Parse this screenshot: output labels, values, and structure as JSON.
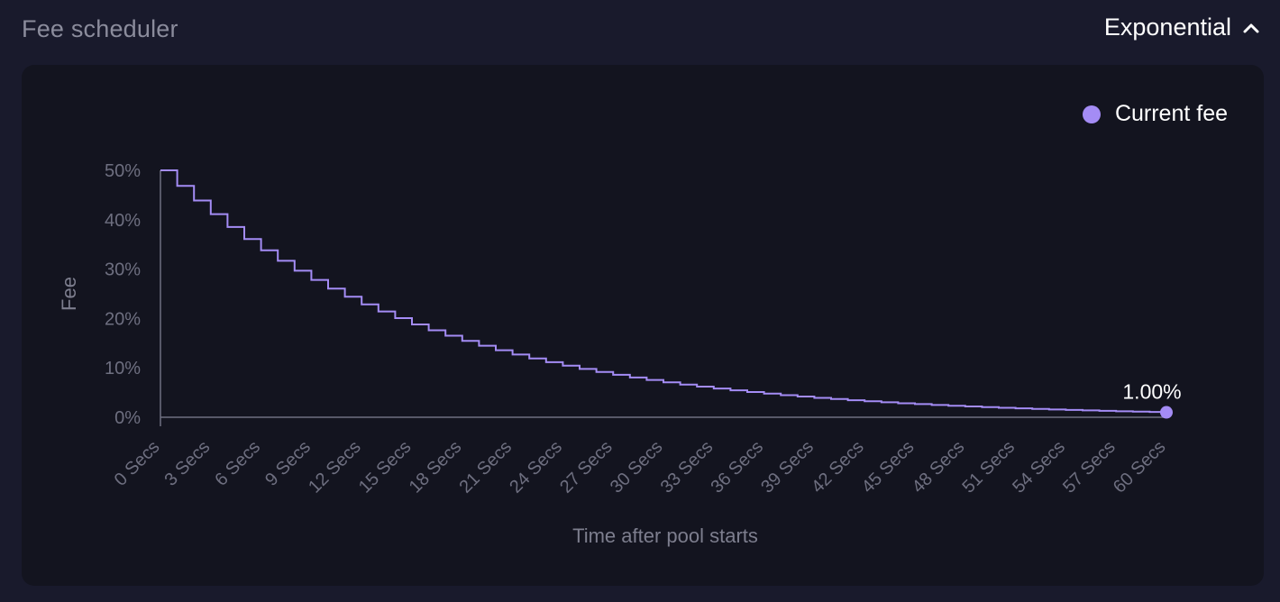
{
  "header": {
    "title": "Fee scheduler",
    "mode_label": "Exponential"
  },
  "legend": {
    "label": "Current fee"
  },
  "colors": {
    "series": "#a48cf5",
    "axis": "#6e6f80"
  },
  "icons": {
    "toggle": "chevron-up-icon"
  },
  "chart_data": {
    "type": "line",
    "step": true,
    "ylabel": "Fee",
    "xlabel": "Time after pool starts",
    "ylim": [
      0,
      50
    ],
    "xlim": [
      0,
      60
    ],
    "y_ticks": [
      "0%",
      "10%",
      "20%",
      "30%",
      "40%",
      "50%"
    ],
    "x_ticks": [
      "0 Secs",
      "3 Secs",
      "6 Secs",
      "9 Secs",
      "12 Secs",
      "15 Secs",
      "18 Secs",
      "21 Secs",
      "24 Secs",
      "27 Secs",
      "30 Secs",
      "33 Secs",
      "36 Secs",
      "39 Secs",
      "42 Secs",
      "45 Secs",
      "48 Secs",
      "51 Secs",
      "54 Secs",
      "57 Secs",
      "60 Secs"
    ],
    "series": [
      {
        "name": "Current fee",
        "start_fee": 50,
        "end_fee": 1,
        "end_label": "1.00%"
      }
    ]
  }
}
